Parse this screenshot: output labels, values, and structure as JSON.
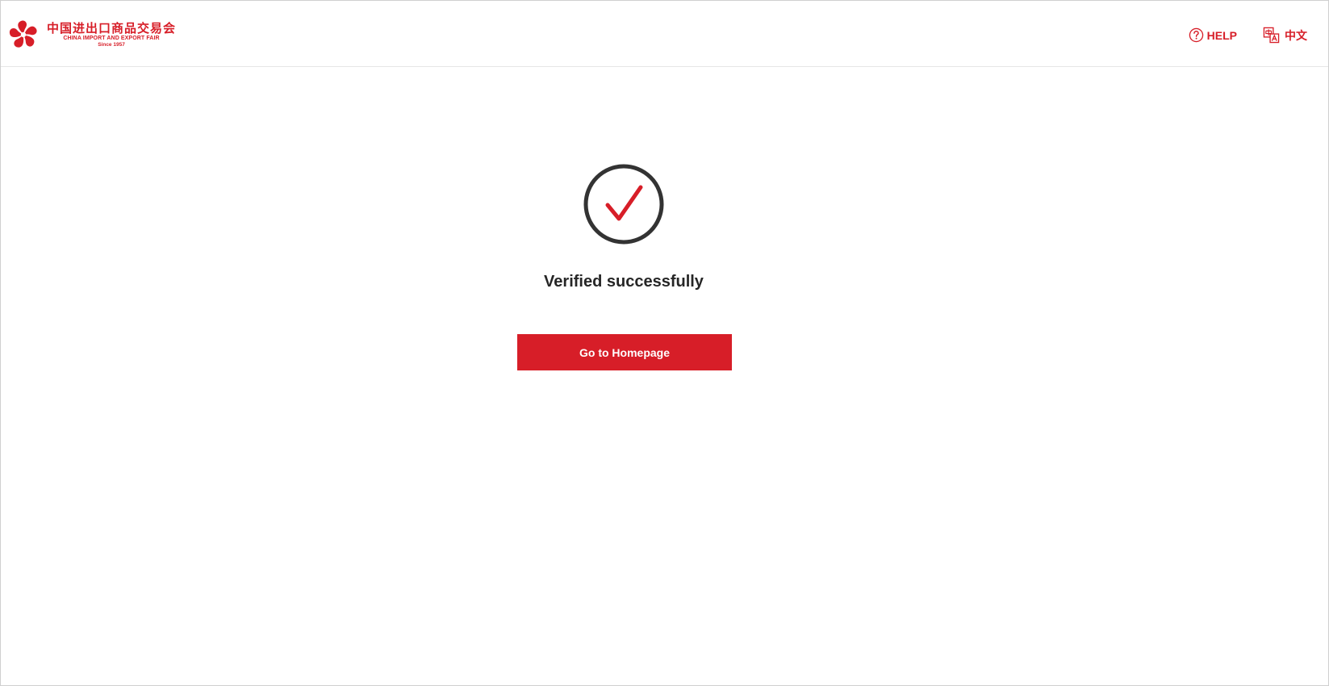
{
  "header": {
    "logo": {
      "name_cn": "中国进出口商品交易会",
      "name_en": "CHINA IMPORT AND EXPORT FAIR",
      "since": "Since 1957",
      "icon": "canton-fair-flower-logo"
    },
    "help": {
      "label": "HELP",
      "icon": "question-circle-icon"
    },
    "language": {
      "label": "中文",
      "icon": "translate-icon"
    }
  },
  "main": {
    "status_icon": "check-circle-icon",
    "title": "Verified successfully",
    "button_label": "Go to Homepage"
  },
  "colors": {
    "brand_red": "#d71e28",
    "text_dark": "#262626",
    "circle_gray": "#333333"
  }
}
